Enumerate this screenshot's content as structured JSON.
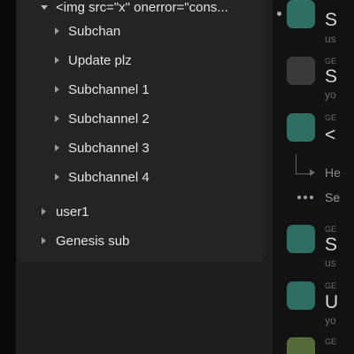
{
  "channel_tree": {
    "rows": [
      {
        "label": "<img src=\"x\" onerror=\"cons...",
        "caret": "down",
        "indent": 1
      },
      {
        "label": "Subchan",
        "caret": "right",
        "indent": 2
      },
      {
        "label": "Update plz",
        "caret": "right",
        "indent": 2
      },
      {
        "label": "Subchannel 1",
        "caret": "right",
        "indent": 2
      },
      {
        "label": "Subchannel 2",
        "caret": "right",
        "indent": 2
      },
      {
        "label": "Subchannel 3",
        "caret": "right",
        "indent": 2
      },
      {
        "label": "Subchannel 4",
        "caret": "right",
        "indent": 2
      },
      {
        "label": "user1",
        "caret": "right",
        "indent": 1
      },
      {
        "label": "Genesis sub",
        "caret": "right",
        "indent": 1
      }
    ]
  },
  "feed": {
    "items": [
      {
        "server": "GE",
        "title": "S",
        "sub": "us",
        "avatar_color": "#2e6e63",
        "unread": true
      },
      {
        "server": "GE",
        "title": "S",
        "sub": "yo",
        "avatar_color": "#3a3a3a",
        "unread": false
      },
      {
        "server": "GE",
        "title": "<",
        "sub": "",
        "avatar_color": "#2e6e63",
        "unread": false
      },
      {
        "server": "GE",
        "title": "S",
        "sub": "us",
        "avatar_color": "#2e6e63",
        "unread": false
      },
      {
        "server": "GE",
        "title": "U",
        "sub": "yo",
        "avatar_color": "#2e6e63",
        "unread": false
      },
      {
        "server": "GE",
        "title": "",
        "sub": "",
        "avatar_color": "#556b3a",
        "unread": false
      }
    ],
    "thread_reply": "He",
    "more_text": "Se"
  },
  "colors": {
    "background": "#0c0c0c",
    "sidebar": "#1e1e1e",
    "tree_panel": "#242424",
    "text": "#e4e4e4",
    "accent_teal": "#2e6e63"
  }
}
